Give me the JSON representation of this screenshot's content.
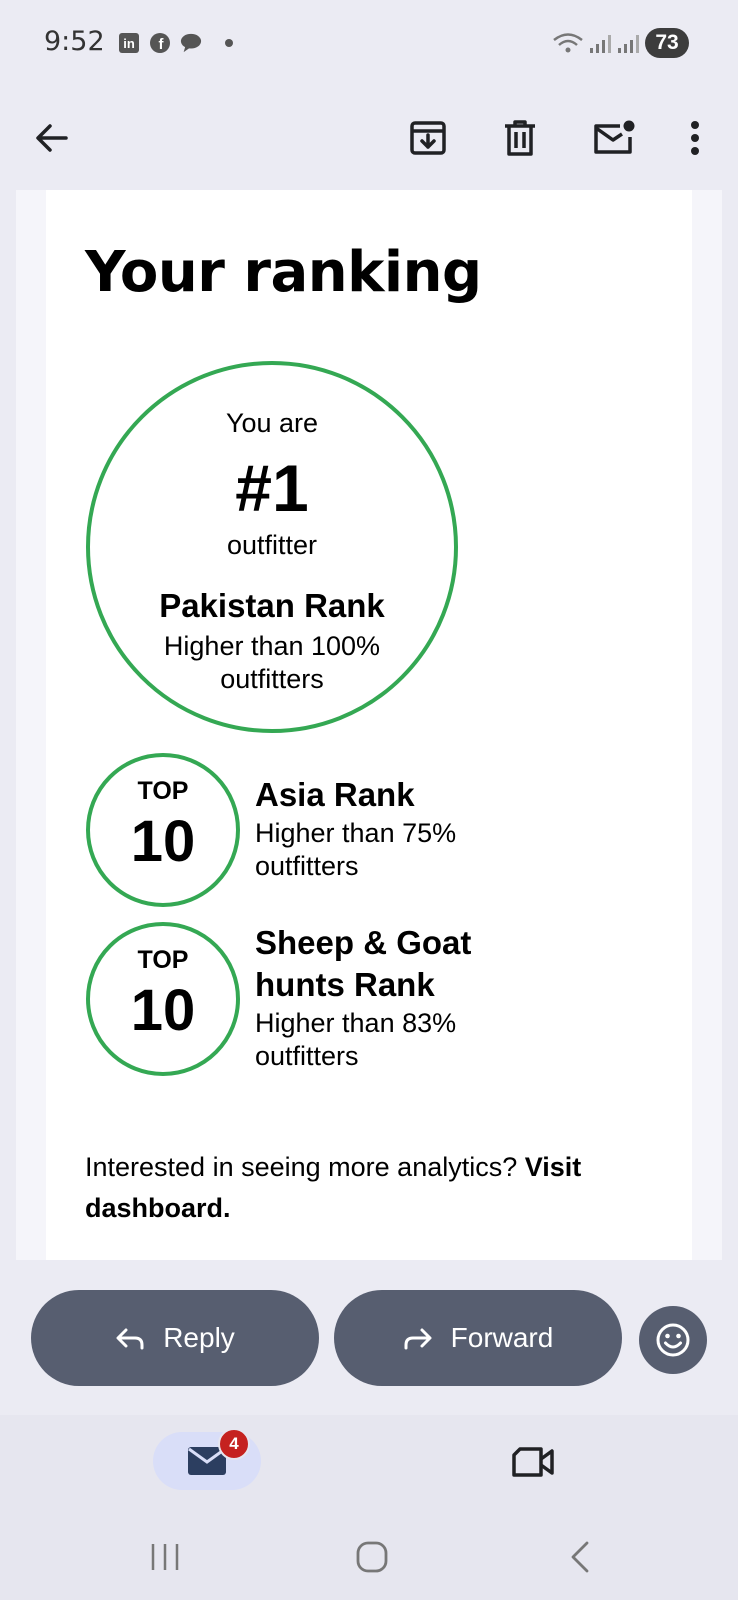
{
  "status_bar": {
    "time": "9:52",
    "battery": "73",
    "icons": [
      "linkedin-icon",
      "facebook-icon",
      "chat-icon",
      "dot-icon",
      "wifi-icon",
      "signal-icon",
      "signal-icon"
    ]
  },
  "toolbar": {
    "icons": [
      "back-arrow-icon",
      "archive-icon",
      "delete-icon",
      "mark-unread-icon",
      "more-vert-icon"
    ]
  },
  "email": {
    "heading": "Your ranking",
    "main_rank": {
      "prefix": "You are",
      "number": "#1",
      "unit": "outfitter",
      "title": "Pakistan Rank",
      "description": "Higher than 100% outfitters"
    },
    "ranks": [
      {
        "badge_top": "TOP",
        "badge_num": "10",
        "title": "Asia Rank",
        "description": "Higher than 75% outfitters"
      },
      {
        "badge_top": "TOP",
        "badge_num": "10",
        "title": "Sheep & Goat hunts Rank",
        "description": "Higher than 83% outfitters"
      }
    ],
    "analytics_text": "Interested in seeing more analytics?",
    "analytics_link": "Visit dashboard."
  },
  "actions": {
    "reply_label": "Reply",
    "forward_label": "Forward"
  },
  "bottom_nav": {
    "mail_badge": "4"
  },
  "colors": {
    "accent_green": "#34a853",
    "pill": "#575e70",
    "badge_red": "#c5221f"
  }
}
